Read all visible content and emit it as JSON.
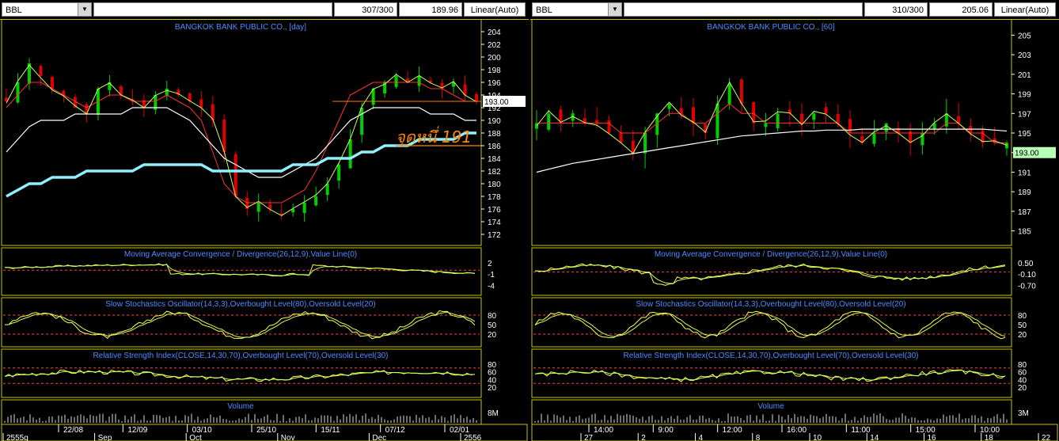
{
  "panels": [
    {
      "symbol": "BBL",
      "count": "307/300",
      "price": "189.96",
      "scale": "Linear(Auto)",
      "title": "BANGKOK BANK PUBLIC CO., [day]",
      "price_ticks": [
        "204",
        "202",
        "200",
        "198",
        "196",
        "194",
        "192",
        "190",
        "188",
        "186",
        "184",
        "182",
        "180",
        "178",
        "176",
        "174",
        "172"
      ],
      "last_price": "193.00",
      "annotation": "จุดหนึ่ 191",
      "macd_title": "Moving Average Convergence / Divergence(26,12,9),Value Line(0)",
      "macd_ticks": [
        "2",
        "-1",
        "-4"
      ],
      "stoch_title": "Slow Stochastics Oscillator(14,3,3),Overbought Level(80),Oversold Level(20)",
      "stoch_ticks": [
        "80",
        "50",
        "20"
      ],
      "rsi_title": "Relative Strength Index(CLOSE,14,30,70),Overbought Level(70),Oversold Level(30)",
      "rsi_ticks": [
        "80",
        "60",
        "40",
        "20"
      ],
      "volume_title": "Volume",
      "volume_tick": "8M",
      "date_row1": [
        "22/08",
        "12/09",
        "03/10",
        "25/10",
        "15/11",
        "07/12",
        "02/01"
      ],
      "date_row2": [
        "2555g",
        "Sep",
        "Oct",
        "Nov",
        "Dec",
        "2556"
      ]
    },
    {
      "symbol": "BBL",
      "count": "310/300",
      "price": "205.06",
      "scale": "Linear(Auto)",
      "title": "BANGKOK BANK PUBLIC CO., [60]",
      "price_ticks": [
        "205",
        "203",
        "201",
        "199",
        "197",
        "195",
        "193",
        "191",
        "189",
        "187",
        "185"
      ],
      "last_price": "193.00",
      "macd_title": "Moving Average Convergence / Divergence(26,12,9),Value Line(0)",
      "macd_ticks": [
        "0.50",
        "-0.10",
        "-0.70"
      ],
      "stoch_title": "Slow Stochastics Oscillator(14,3,3),Overbought Level(80),Oversold Level(20)",
      "stoch_ticks": [
        "80",
        "50",
        "20"
      ],
      "rsi_title": "Relative Strength Index(CLOSE,14,30,70),Overbought Level(70),Oversold Level(30)",
      "rsi_ticks": [
        "80",
        "60",
        "40",
        "20"
      ],
      "volume_title": "Volume",
      "volume_tick": "3M",
      "date_row1": [
        "14:00",
        "9:00",
        "12:00",
        "16:00",
        "11:00",
        "15:00",
        "10:00"
      ],
      "date_row2": [
        "27",
        "2",
        "4",
        "8",
        "10",
        "14",
        "16",
        "18",
        "22"
      ]
    }
  ],
  "chart_data": [
    {
      "type": "line",
      "title": "BANGKOK BANK PUBLIC CO., [day]",
      "ylim": [
        171,
        205
      ],
      "last_price": 193.0,
      "series": [
        {
          "values": [
            193,
            196,
            199,
            197,
            195,
            194,
            192,
            191,
            195,
            196,
            194,
            193,
            192,
            194,
            195,
            194,
            193,
            192,
            190,
            185,
            178,
            176,
            177,
            176,
            175,
            176,
            177,
            178,
            180,
            183,
            187,
            192,
            195,
            196,
            197,
            196,
            197,
            196,
            195,
            196,
            194,
            193
          ]
        },
        {
          "values": [
            192,
            194,
            196,
            196,
            195,
            194,
            193,
            192,
            193,
            194,
            194,
            193,
            193,
            193,
            194,
            193,
            192,
            190,
            185,
            180,
            178,
            177,
            177,
            177,
            177,
            178,
            179,
            182,
            186,
            190,
            194,
            195,
            196,
            196,
            196,
            196,
            196,
            195,
            195,
            194,
            193,
            193
          ]
        },
        {
          "values": [
            185,
            187,
            189,
            190,
            190,
            190,
            191,
            191,
            191,
            191,
            191,
            192,
            192,
            192,
            192,
            191,
            190,
            188,
            186,
            184,
            183,
            182,
            181,
            181,
            181,
            182,
            183,
            184,
            186,
            188,
            190,
            191,
            192,
            192,
            192,
            192,
            192,
            191,
            191,
            191,
            190,
            190
          ]
        },
        {
          "values": [
            178,
            179,
            180,
            180,
            181,
            181,
            181,
            182,
            182,
            182,
            182,
            182,
            183,
            183,
            183,
            183,
            183,
            183,
            182,
            182,
            182,
            182,
            182,
            182,
            182,
            183,
            183,
            183,
            184,
            184,
            184,
            185,
            185,
            186,
            186,
            186,
            187,
            187,
            187,
            187,
            188,
            188
          ]
        }
      ]
    },
    {
      "type": "line",
      "title": "BANGKOK BANK PUBLIC CO., [60]",
      "ylim": [
        184,
        206
      ],
      "last_price": 193.0,
      "series": [
        {
          "values": [
            196,
            197,
            196,
            197,
            196,
            196,
            195,
            194,
            193,
            195,
            197,
            198,
            197,
            196,
            195,
            198,
            200,
            198,
            196,
            196,
            197,
            197,
            196,
            197,
            197,
            196,
            195,
            194,
            195,
            196,
            195,
            194,
            195,
            196,
            197,
            196,
            195,
            194,
            194,
            194
          ]
        },
        {
          "values": [
            196,
            196,
            196,
            196,
            196,
            196,
            196,
            195,
            195,
            195,
            196,
            197,
            197,
            196,
            196,
            197,
            198,
            197,
            197,
            196,
            196,
            196,
            196,
            196,
            196,
            196,
            195,
            195,
            195,
            195,
            195,
            195,
            195,
            195,
            196,
            196,
            195,
            195,
            194,
            194
          ]
        },
        {
          "values": [
            191,
            191.3,
            191.6,
            191.9,
            192.1,
            192.3,
            192.5,
            192.7,
            192.9,
            193.1,
            193.3,
            193.5,
            193.7,
            193.9,
            194.1,
            194.3,
            194.5,
            194.7,
            194.8,
            194.9,
            195,
            195.1,
            195.2,
            195.2,
            195.3,
            195.3,
            195.3,
            195.4,
            195.4,
            195.4,
            195.4,
            195.4,
            195.4,
            195.4,
            195.4,
            195.4,
            195.4,
            195.4,
            195.3,
            195.2
          ]
        }
      ]
    }
  ]
}
